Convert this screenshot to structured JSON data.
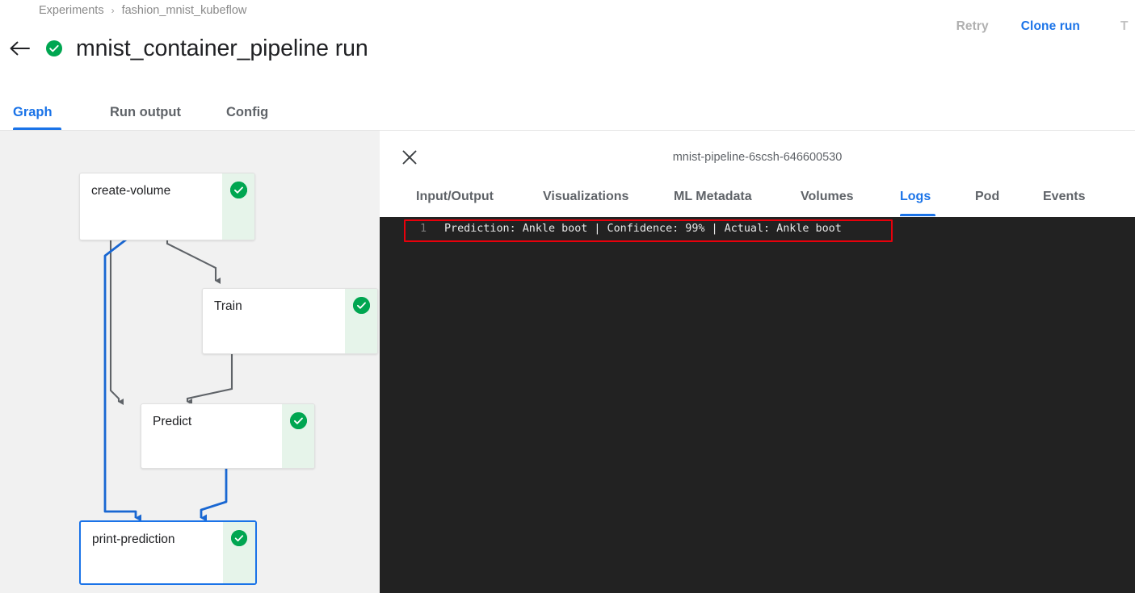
{
  "header": {
    "breadcrumb": {
      "items": [
        "Experiments",
        "fashion_mnist_kubeflow"
      ],
      "separator": "›"
    },
    "back_icon": "arrow-left-icon",
    "run_status_icon": "check-circle-icon",
    "title": "mnist_container_pipeline run",
    "actions": {
      "retry": "Retry",
      "clone_run": "Clone run",
      "terminate_partial": "T"
    }
  },
  "main_tabs": [
    {
      "label": "Graph",
      "active": true
    },
    {
      "label": "Run output",
      "active": false
    },
    {
      "label": "Config",
      "active": false
    }
  ],
  "graph": {
    "nodes": [
      {
        "label": "create-volume",
        "status": "succeeded",
        "selected": false
      },
      {
        "label": "Train",
        "status": "succeeded",
        "selected": false
      },
      {
        "label": "Predict",
        "status": "succeeded",
        "selected": false
      },
      {
        "label": "print-prediction",
        "status": "succeeded",
        "selected": true
      }
    ],
    "status_icon": "check-circle-icon"
  },
  "side_panel": {
    "close_icon": "close-icon",
    "pod_name": "mnist-pipeline-6scsh-646600530",
    "tabs": [
      {
        "label": "Input/Output",
        "active": false
      },
      {
        "label": "Visualizations",
        "active": false
      },
      {
        "label": "ML Metadata",
        "active": false
      },
      {
        "label": "Volumes",
        "active": false
      },
      {
        "label": "Logs",
        "active": true
      },
      {
        "label": "Pod",
        "active": false
      },
      {
        "label": "Events",
        "active": false
      }
    ],
    "logs": [
      {
        "line_number": "1",
        "text": "Prediction: Ankle boot | Confidence: 99% | Actual: Ankle boot",
        "highlighted": true
      }
    ]
  },
  "colors": {
    "accent_blue": "#1a73e8",
    "status_green": "#00a651",
    "status_green_bg": "#e6f4ea",
    "log_background": "#222222",
    "graph_background": "#f1f1f1",
    "highlight_red": "#e8000b"
  }
}
